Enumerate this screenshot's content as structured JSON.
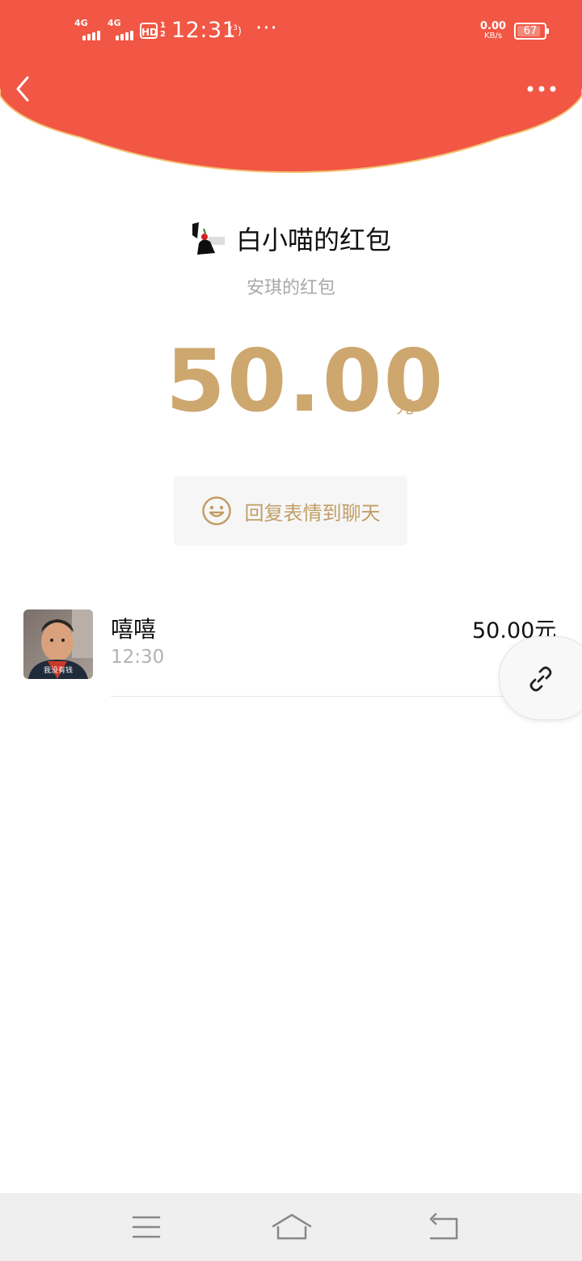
{
  "status_bar": {
    "signal1_label": "4G",
    "signal2_label": "4G",
    "hd_label": "HD",
    "hd_top": "1",
    "hd_bottom": "2",
    "time": "12:31",
    "hotspot_number": "3",
    "more_dots": "···",
    "net_speed_value": "0.00",
    "net_speed_unit": "KB/s",
    "battery_level": "67"
  },
  "header": {
    "back_icon": "chevron-left-icon",
    "more_icon": "more-dots-icon",
    "background_color": "#f25644",
    "border_color": "#f3c173"
  },
  "sender": {
    "title": "白小喵的红包",
    "subtitle": "安琪的红包"
  },
  "amount": {
    "value": "50.00",
    "unit": "元",
    "color": "#cda76e"
  },
  "reply_button": {
    "label": "回复表情到聊天",
    "icon": "smiley-icon"
  },
  "record": {
    "name": "嘻嘻",
    "time": "12:30",
    "amount": "50.00元",
    "avatar_caption": "我没有钱"
  },
  "floating_button": {
    "icon": "link-icon"
  },
  "nav_bar": {
    "menu_icon": "menu-icon",
    "home_icon": "home-icon",
    "back_icon": "back-arrow-icon"
  }
}
